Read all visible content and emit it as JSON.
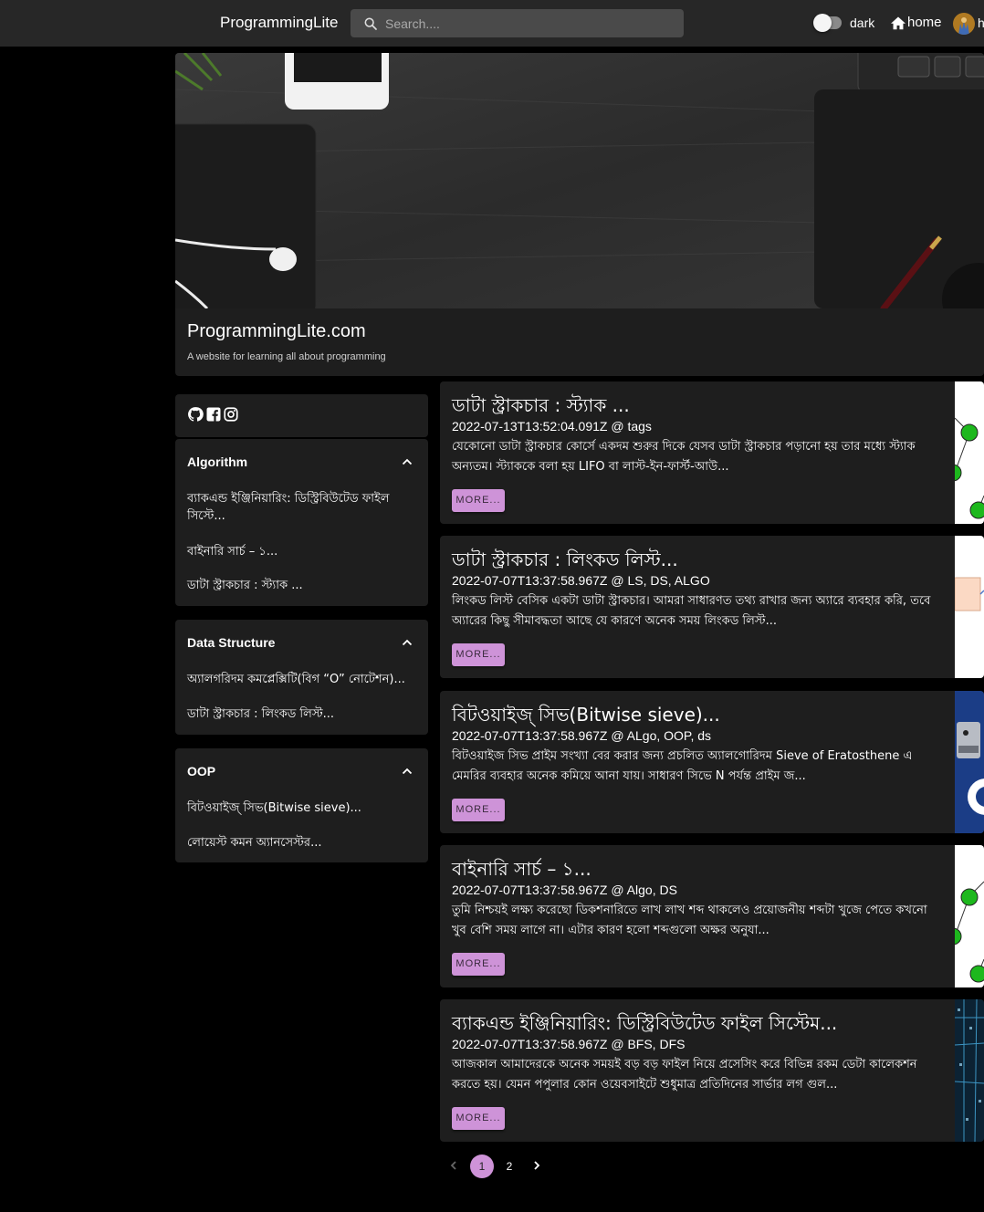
{
  "header": {
    "brand": "ProgrammingLite",
    "search_placeholder": "Search....",
    "theme_label": "dark",
    "home_label": "home",
    "user_initial": "h"
  },
  "hero": {
    "title": "ProgrammingLite.com",
    "subtitle": "A website for learning all about programming"
  },
  "sidebar": {
    "social_icons": [
      "github-icon",
      "facebook-icon",
      "instagram-icon"
    ],
    "categories": [
      {
        "title": "Algorithm",
        "links": [
          "ব্যাকএন্ড ইঞ্জিনিয়ারিং: ডিস্ট্রিবিউটেড ফাইল সিস্টে...",
          "বাইনারি সার্চ – ১...",
          "ডাটা স্ট্রাকচার : স্ট্যাক ..."
        ]
      },
      {
        "title": "Data Structure",
        "links": [
          "অ্যালগরিদম কমপ্লেক্সিটি(বিগ “O” নোটেশন)...",
          "ডাটা স্ট্রাকচার : লিংকড লিস্ট..."
        ]
      },
      {
        "title": "OOP",
        "links": [
          "বিটওয়াইজ্ সিভ(Bitwise sieve)...",
          "লোয়েস্ট কমন অ্যানসেস্টর..."
        ]
      }
    ]
  },
  "posts": [
    {
      "title": "ডাটা স্ট্রাকচার : স্ট্যাক ...",
      "meta": "2022-07-13T13:52:04.091Z @ tags",
      "excerpt": "যেকোনো ডাটা স্ট্রাকচার কোর্সে একদম শুরুর দিকে যেসব ডাটা স্ট্রাকচার পড়ানো হয় তার মধ্যে স্ট্যাক অন্যতম। স্ট্যাককে বলা হয় LIFO বা লাস্ট-ইন-ফার্স্ট-আউ...",
      "more_label": "MORE..."
    },
    {
      "title": "ডাটা স্ট্রাকচার : লিংকড লিস্ট...",
      "meta": "2022-07-07T13:37:58.967Z @ LS, DS, ALGO",
      "excerpt": "লিংকড লিস্ট বেসিক একটা ডাটা স্ট্রাকচার। আমরা সাধারণত তথ্য রাখার জন্য অ্যারে ব্যবহার করি, তবে অ্যারের কিছু সীমাবদ্ধতা আছে যে কারণে অনেক সময় লিংকড লিস্ট...",
      "more_label": "MORE..."
    },
    {
      "title": "বিটওয়াইজ্ সিভ(Bitwise sieve)...",
      "meta": "2022-07-07T13:37:58.967Z @ ALgo, OOP, ds",
      "excerpt": "বিটওয়াইজ সিভ প্রাইম সংখ্যা বের করার জন্য প্রচলিত অ্যালগোরিদম Sieve of Eratosthene এ মেমরির ব্যবহার অনেক কমিয়ে আনা যায়। সাধারণ সিভে N পর্যন্ত প্রাইম জ...",
      "more_label": "MORE..."
    },
    {
      "title": "বাইনারি সার্চ – ১...",
      "meta": "2022-07-07T13:37:58.967Z @ Algo, DS",
      "excerpt": "তুমি নিশ্চয়ই লক্ষ্য করেছো ডিকশনারিতে লাখ লাখ শব্দ থাকলেও প্রয়োজনীয় শব্দটা খুজে পেতে কখনো খুব বেশি সময় লাগে না। এটার কারণ হলো শব্দগুলো অক্ষর অনুযা...",
      "more_label": "MORE..."
    },
    {
      "title": "ব্যাকএন্ড ইঞ্জিনিয়ারিং: ডিস্ট্রিবিউটেড ফাইল সিস্টেম...",
      "meta": "2022-07-07T13:37:58.967Z @ BFS, DFS",
      "excerpt": "আজকাল আমাদেরকে অনেক সময়ই বড় বড় ফাইল নিয়ে প্রসেসিং করে বিভিন্ন রকম ডেটা কালেকশন করতে হয়। যেমন পপুলার কোন ওয়েবসাইটে শুধুমাত্র প্রতিদিনের সার্ভার লগ গুল...",
      "more_label": "MORE..."
    }
  ],
  "pagination": {
    "current": "1",
    "next_page": "2"
  },
  "colors": {
    "accent": "#ce93d8",
    "card": "#1e1e1e",
    "appbar": "#272727",
    "background": "#000000"
  }
}
